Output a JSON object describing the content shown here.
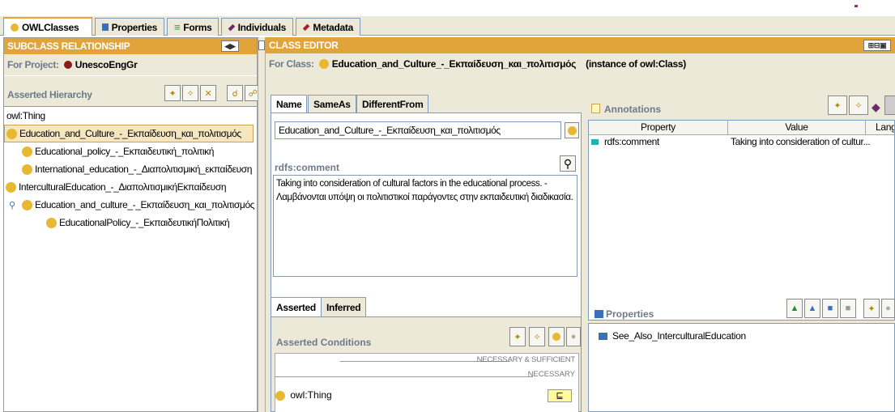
{
  "tabs": [
    {
      "label": "OWLClasses",
      "icon": "class-circle-icon",
      "color": "#e8b830",
      "active": true
    },
    {
      "label": "Properties",
      "icon": "property-square-icon",
      "color": "#3c6fb9",
      "active": false
    },
    {
      "label": "Forms",
      "icon": "forms-lines-icon",
      "color": "#3a9a3a",
      "active": false
    },
    {
      "label": "Individuals",
      "icon": "individual-diamond-icon",
      "color": "#6b2a6b",
      "active": false
    },
    {
      "label": "Metadata",
      "icon": "metadata-diamond-icon",
      "color": "#b01c2a",
      "active": false
    }
  ],
  "left": {
    "header": "SUBCLASS RELATIONSHIP",
    "project_label": "For Project:",
    "project_name": "UnescoEngGr",
    "hierarchy_label": "Asserted Hierarchy",
    "tree": [
      {
        "label": "owl:Thing",
        "level": 0,
        "dot": false,
        "selected": false,
        "expander": false
      },
      {
        "label": "Education_and_Culture_-_Εκπαίδευση_και_πολιτισμός",
        "level": 0,
        "dot": true,
        "selected": true,
        "expander": false
      },
      {
        "label": "Educational_policy_-_Εκπαιδευτική_πολιτική",
        "level": 1,
        "dot": true,
        "selected": false,
        "expander": false
      },
      {
        "label": "International_education_-_Διαπολιτισμική_εκπαίδευση",
        "level": 1,
        "dot": true,
        "selected": false,
        "expander": false
      },
      {
        "label": "InterculturalEducation_-_ΔιαπολιτισμικήΕκπαίδευση",
        "level": 0,
        "dot": true,
        "selected": false,
        "expander": false
      },
      {
        "label": "Education_and_culture_-_Εκπαίδευση_και_πολιτισμός",
        "level": 0,
        "dot": true,
        "selected": false,
        "expander": true
      },
      {
        "label": "EducationalPolicy_-_ΕκπαιδευτικήΠολιτική",
        "level": 2,
        "dot": true,
        "selected": false,
        "expander": false
      }
    ]
  },
  "right": {
    "header": "CLASS EDITOR",
    "for_class_label": "For Class:",
    "class_name": "Education_and_Culture_-_Εκπαίδευση_και_πολιτισμός",
    "instance_text": "(instance of owl:Class)",
    "name_tabs": [
      "Name",
      "SameAs",
      "DifferentFrom"
    ],
    "name_value": "Education_and_Culture_-_Εκπαίδευση_και_πολιτισμός",
    "rdfs_label": "rdfs:comment",
    "comment_text": "Taking into consideration of cultural factors in the educational process. - Λαμβάνονται υπόψη οι πολιτιστικοί παράγοντες στην εκπαιδευτική διαδικασία.",
    "annotations": {
      "title": "Annotations",
      "columns": [
        "Property",
        "Value",
        "Lang"
      ],
      "rows": [
        {
          "property": "rdfs:comment",
          "value": "Taking into consideration of cultur..."
        }
      ]
    },
    "cond_tabs": [
      "Asserted",
      "Inferred"
    ],
    "asserted_conditions_label": "Asserted Conditions",
    "necessary_sufficient": "NECESSARY & SUFFICIENT",
    "necessary": "NECESSARY",
    "condition_item": "owl:Thing",
    "condition_badge": "⊑",
    "properties": {
      "title": "Properties",
      "items": [
        "See_Also_InterculturalEducation"
      ]
    }
  },
  "colors": {
    "header_orange": "#e0a43a",
    "class_dot": "#e8b830",
    "selection": "#f6e6c0",
    "project_dot": "#8b1a1a"
  }
}
